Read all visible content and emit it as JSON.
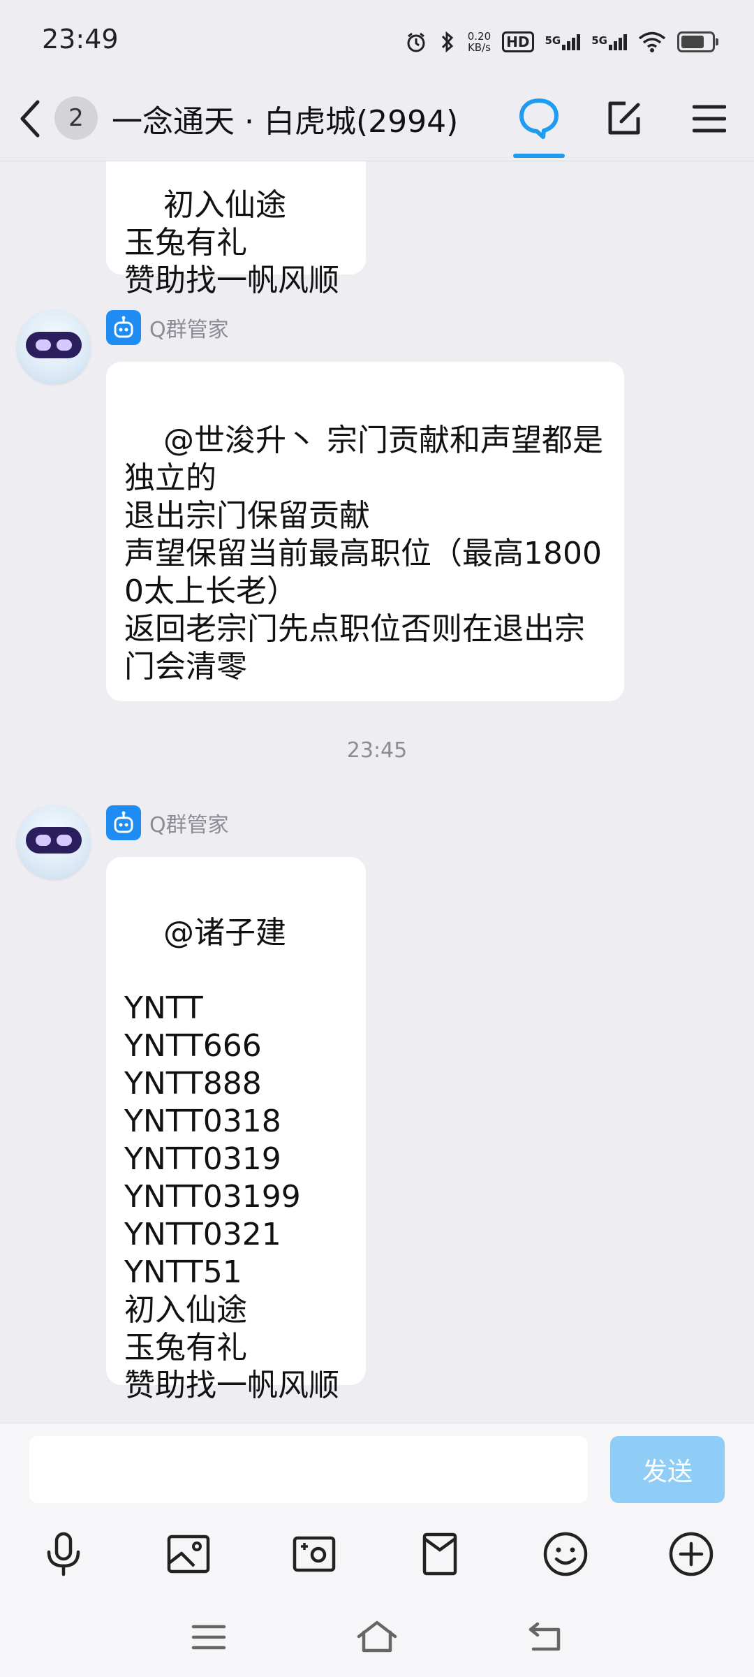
{
  "status_bar": {
    "time": "23:49",
    "net_speed_value": "0.20",
    "net_speed_unit": "KB/s",
    "hd_label": "HD",
    "network_1": "5G",
    "network_2": "5G",
    "battery_level": 0.85
  },
  "header": {
    "unread_count": "2",
    "title": "一念通天 · 白虎城(2994)",
    "accent_color": "#1f9bf0"
  },
  "messages": [
    {
      "type": "text",
      "sender": "",
      "text": "初入仙途\n玉兔有礼\n赞助找一帆风顺"
    },
    {
      "type": "text",
      "sender": "Q群管家",
      "text": "@世浚升丶 宗门贡献和声望都是独立的\n退出宗门保留贡献\n声望保留当前最高职位（最高18000太上长老）\n返回老宗门先点职位否则在退出宗门会清零"
    },
    {
      "type": "time",
      "text": "23:45"
    },
    {
      "type": "text",
      "sender": "Q群管家",
      "text": "@诸子建\n\nYNTT\nYNTT666\nYNTT888\nYNTT0318\nYNTT0319\nYNTT03199\nYNTT0321\nYNTT51\n初入仙途\n玉兔有礼\n赞助找一帆风顺"
    }
  ],
  "input": {
    "value": "",
    "placeholder": "",
    "send_label": "发送"
  },
  "toolbar_icons": [
    "microphone-icon",
    "image-icon",
    "camera-icon",
    "red-packet-icon",
    "emoji-icon",
    "plus-icon"
  ],
  "nav_icons": [
    "menu-icon",
    "home-icon",
    "back-icon"
  ]
}
